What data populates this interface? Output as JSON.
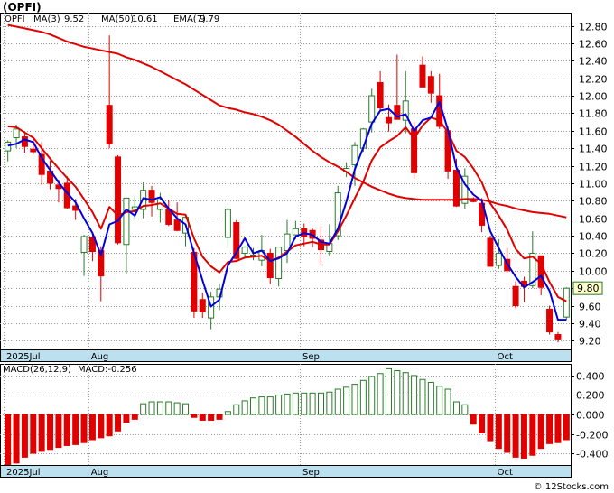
{
  "title": "(OPFI)",
  "credit": "© 12Stocks.com",
  "colors": {
    "up": "#2a7a2a",
    "down": "#e00000",
    "ma3": "#0000dd",
    "ma50": "#e00000",
    "ema7": "#e00000",
    "grid": "#999999",
    "axisband": "#bde0ef"
  },
  "chart_data": [
    {
      "type": "candlestick",
      "legend": {
        "symbol": "OPFI",
        "items": [
          "MA(3)",
          "9.52",
          "MA(50)",
          "10.61",
          "EMA(7)",
          "9.79"
        ]
      },
      "ylim": [
        9.1,
        12.95
      ],
      "yticks": [
        "12.80",
        "12.60",
        "12.40",
        "12.20",
        "12.00",
        "11.80",
        "11.60",
        "11.40",
        "11.20",
        "11.00",
        "10.80",
        "10.60",
        "10.40",
        "10.20",
        "10.00",
        "9.80",
        "9.60",
        "9.40",
        "9.20"
      ],
      "last_price_label": "9.80",
      "last_price": 9.8,
      "xticks": [
        {
          "label": "2025Jul",
          "i": -0.5
        },
        {
          "label": "Aug",
          "i": 9.5
        },
        {
          "label": "Sep",
          "i": 34.5
        },
        {
          "label": "Oct",
          "i": 57.5
        }
      ],
      "candles": [
        [
          11.37,
          11.49,
          11.25,
          11.47
        ],
        [
          11.52,
          11.67,
          11.4,
          11.62
        ],
        [
          11.53,
          11.57,
          11.35,
          11.42
        ],
        [
          11.39,
          11.51,
          11.33,
          11.36
        ],
        [
          11.33,
          11.47,
          10.98,
          11.1
        ],
        [
          11.14,
          11.26,
          10.93,
          11.0
        ],
        [
          10.98,
          11.04,
          10.78,
          10.94
        ],
        [
          11.0,
          11.08,
          10.7,
          10.72
        ],
        [
          10.74,
          10.82,
          10.58,
          10.69
        ],
        [
          10.21,
          10.41,
          9.94,
          10.39
        ],
        [
          10.38,
          10.43,
          10.11,
          10.22
        ],
        [
          10.23,
          10.28,
          9.65,
          9.94
        ],
        [
          11.89,
          12.69,
          11.4,
          11.45
        ],
        [
          11.3,
          11.32,
          10.3,
          10.32
        ],
        [
          10.3,
          10.73,
          9.96,
          10.83
        ],
        [
          10.7,
          10.85,
          10.58,
          10.73
        ],
        [
          10.7,
          11.01,
          10.6,
          10.92
        ],
        [
          10.92,
          10.97,
          10.62,
          10.78
        ],
        [
          10.7,
          10.89,
          10.55,
          10.81
        ],
        [
          10.7,
          10.81,
          10.51,
          10.53
        ],
        [
          10.58,
          10.78,
          10.45,
          10.46
        ],
        [
          10.43,
          10.64,
          10.28,
          10.61
        ],
        [
          10.21,
          10.26,
          9.46,
          9.54
        ],
        [
          9.67,
          9.75,
          9.46,
          9.53
        ],
        [
          9.46,
          9.76,
          9.33,
          9.7
        ],
        [
          9.7,
          9.85,
          9.55,
          9.79
        ],
        [
          10.38,
          10.72,
          10.26,
          10.7
        ],
        [
          10.55,
          10.58,
          10.13,
          10.14
        ],
        [
          10.2,
          10.28,
          10.14,
          10.27
        ],
        [
          10.17,
          10.26,
          10.12,
          10.18
        ],
        [
          10.12,
          10.41,
          10.05,
          10.23
        ],
        [
          10.2,
          10.25,
          9.85,
          9.92
        ],
        [
          9.91,
          10.27,
          9.82,
          10.27
        ],
        [
          10.23,
          10.58,
          10.09,
          10.42
        ],
        [
          10.41,
          10.57,
          10.36,
          10.48
        ],
        [
          10.48,
          10.54,
          10.28,
          10.39
        ],
        [
          10.46,
          10.48,
          10.27,
          10.37
        ],
        [
          10.35,
          10.51,
          10.07,
          10.24
        ],
        [
          10.22,
          10.53,
          10.17,
          10.31
        ],
        [
          10.4,
          10.97,
          10.35,
          10.89
        ],
        [
          11.13,
          11.24,
          11.07,
          11.17
        ],
        [
          11.21,
          11.47,
          10.97,
          11.43
        ],
        [
          11.4,
          11.63,
          11.36,
          11.62
        ],
        [
          11.7,
          12.08,
          11.58,
          12.0
        ],
        [
          12.15,
          12.28,
          11.84,
          11.86
        ],
        [
          11.75,
          11.9,
          11.59,
          11.69
        ],
        [
          11.89,
          12.47,
          11.8,
          11.73
        ],
        [
          11.72,
          12.28,
          11.57,
          11.94
        ],
        [
          11.62,
          11.7,
          11.05,
          11.12
        ],
        [
          12.35,
          12.45,
          12.1,
          12.1
        ],
        [
          12.22,
          12.28,
          11.92,
          12.03
        ],
        [
          12.0,
          12.25,
          11.62,
          11.65
        ],
        [
          11.6,
          11.65,
          11.05,
          11.14
        ],
        [
          11.15,
          11.28,
          10.73,
          10.74
        ],
        [
          10.77,
          11.17,
          10.71,
          11.08
        ],
        [
          10.82,
          10.84,
          10.78,
          10.79
        ],
        [
          10.77,
          10.83,
          10.44,
          10.52
        ],
        [
          10.37,
          10.4,
          10.05,
          10.05
        ],
        [
          10.06,
          10.36,
          10.02,
          10.2
        ],
        [
          10.13,
          10.26,
          9.98,
          10.0
        ],
        [
          9.82,
          9.88,
          9.57,
          9.6
        ],
        [
          9.88,
          9.93,
          9.64,
          9.82
        ],
        [
          9.83,
          10.45,
          9.8,
          10.2
        ],
        [
          10.17,
          10.17,
          9.72,
          9.81
        ],
        [
          9.56,
          9.6,
          9.27,
          9.3
        ],
        [
          9.27,
          9.3,
          9.18,
          9.22
        ],
        [
          9.47,
          9.81,
          9.44,
          9.8
        ]
      ],
      "ma3": [
        11.43,
        11.45,
        11.5,
        11.47,
        11.29,
        11.15,
        11.01,
        10.89,
        10.78,
        10.6,
        10.43,
        10.18,
        10.53,
        10.57,
        10.7,
        10.63,
        10.83,
        10.81,
        10.84,
        10.71,
        10.6,
        10.53,
        10.2,
        9.89,
        9.59,
        9.67,
        10.06,
        10.21,
        10.37,
        10.2,
        10.23,
        10.11,
        10.14,
        10.2,
        10.39,
        10.43,
        10.41,
        10.33,
        10.31,
        10.48,
        10.79,
        11.16,
        11.41,
        11.68,
        11.83,
        11.85,
        11.76,
        11.79,
        11.6,
        11.72,
        11.75,
        11.93,
        11.61,
        11.18,
        10.99,
        10.87,
        10.8,
        10.45,
        10.26,
        10.08,
        9.93,
        9.81,
        9.87,
        9.94,
        9.77,
        9.44,
        9.44
      ],
      "ma50": [
        12.81,
        12.79,
        12.77,
        12.75,
        12.73,
        12.7,
        12.66,
        12.62,
        12.59,
        12.56,
        12.54,
        12.52,
        12.5,
        12.48,
        12.44,
        12.41,
        12.37,
        12.33,
        12.28,
        12.23,
        12.18,
        12.13,
        12.07,
        12.01,
        11.95,
        11.89,
        11.86,
        11.84,
        11.81,
        11.79,
        11.76,
        11.72,
        11.67,
        11.6,
        11.53,
        11.45,
        11.37,
        11.3,
        11.24,
        11.19,
        11.13,
        11.06,
        11.01,
        10.96,
        10.92,
        10.88,
        10.85,
        10.83,
        10.82,
        10.81,
        10.81,
        10.81,
        10.81,
        10.81,
        10.82,
        10.82,
        10.81,
        10.79,
        10.76,
        10.74,
        10.71,
        10.69,
        10.67,
        10.66,
        10.65,
        10.63,
        10.61
      ],
      "ema7": [
        11.65,
        11.64,
        11.58,
        11.52,
        11.4,
        11.28,
        11.17,
        11.06,
        10.96,
        10.82,
        10.67,
        10.48,
        10.73,
        10.63,
        10.67,
        10.68,
        10.74,
        10.75,
        10.77,
        10.71,
        10.65,
        10.64,
        10.37,
        10.16,
        10.05,
        9.98,
        10.1,
        10.11,
        10.15,
        10.16,
        10.17,
        10.11,
        10.15,
        10.22,
        10.29,
        10.31,
        10.33,
        10.3,
        10.3,
        10.45,
        10.63,
        10.83,
        11.02,
        11.26,
        11.41,
        11.48,
        11.54,
        11.64,
        11.51,
        11.66,
        11.75,
        11.72,
        11.58,
        11.37,
        11.3,
        11.17,
        11.01,
        10.77,
        10.63,
        10.47,
        10.25,
        10.14,
        10.16,
        10.08,
        9.87,
        9.7,
        9.65
      ]
    },
    {
      "type": "bar",
      "legend": {
        "items": [
          "MACD(26,12,9)",
          "MACD:-0.256"
        ]
      },
      "ylim": [
        -0.52,
        0.52
      ],
      "yticks": [
        "0.400",
        "0.200",
        "0.000",
        "-0.200",
        "-0.400"
      ],
      "xticks": [
        {
          "label": "2025Jul",
          "i": -0.5
        },
        {
          "label": "Aug",
          "i": 9.5
        },
        {
          "label": "Sep",
          "i": 34.5
        },
        {
          "label": "Oct",
          "i": 57.5
        }
      ],
      "values": [
        -0.52,
        -0.5,
        -0.44,
        -0.4,
        -0.38,
        -0.36,
        -0.34,
        -0.32,
        -0.31,
        -0.29,
        -0.26,
        -0.24,
        -0.22,
        -0.17,
        -0.08,
        -0.05,
        0.11,
        0.13,
        0.13,
        0.13,
        0.12,
        0.11,
        -0.03,
        -0.06,
        -0.06,
        -0.05,
        0.03,
        0.1,
        0.14,
        0.17,
        0.18,
        0.18,
        0.2,
        0.21,
        0.22,
        0.22,
        0.22,
        0.22,
        0.23,
        0.26,
        0.28,
        0.31,
        0.35,
        0.39,
        0.42,
        0.47,
        0.45,
        0.43,
        0.4,
        0.36,
        0.33,
        0.29,
        0.26,
        0.13,
        0.1,
        -0.1,
        -0.19,
        -0.27,
        -0.35,
        -0.39,
        -0.44,
        -0.45,
        -0.42,
        -0.35,
        -0.3,
        -0.29,
        -0.26
      ]
    }
  ]
}
